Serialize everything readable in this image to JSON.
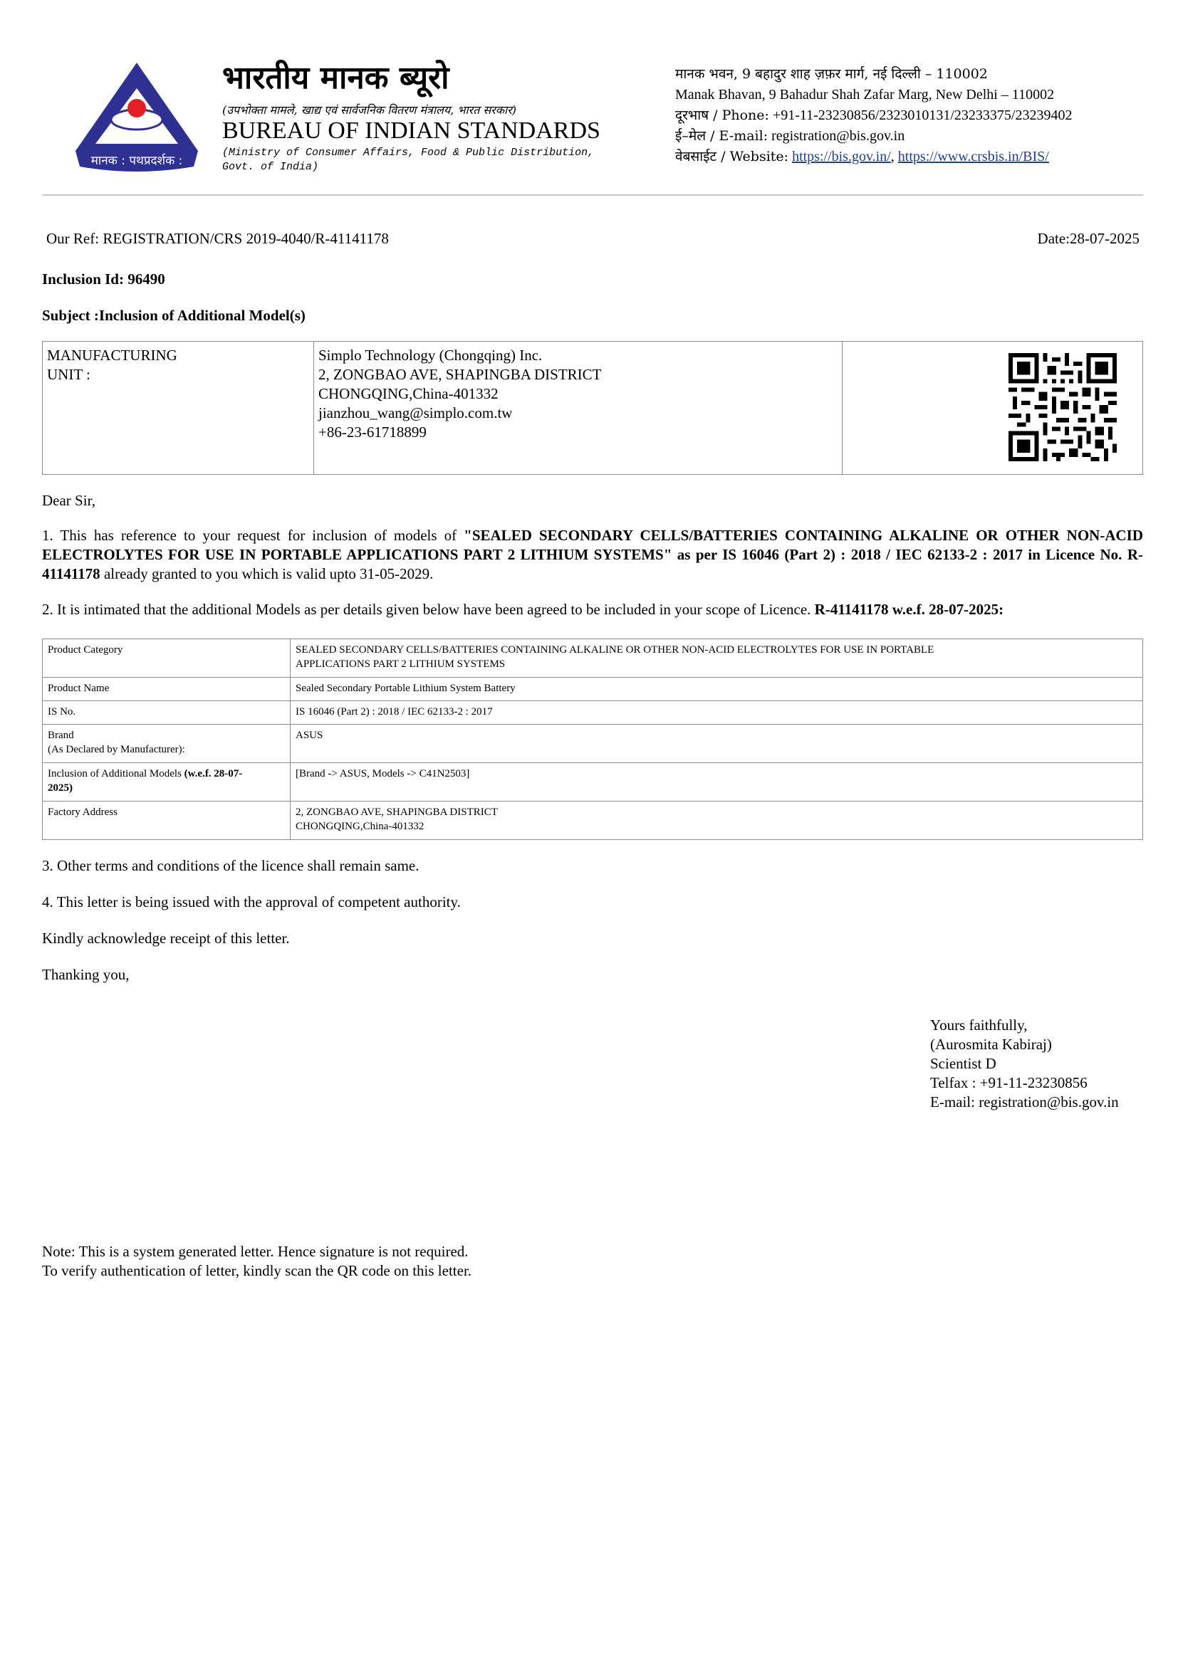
{
  "header": {
    "logo_text": "मानक : पथप्रदर्शक :",
    "hindi_name": "भारतीय मानक ब्यूरो",
    "hindi_ministry": "(उपभोक्ता मामले, खाद्य एवं सार्वजनिक वितरण मंत्रालय, भारत सरकार)",
    "english_name": "BUREAU OF INDIAN STANDARDS",
    "ministry_line1": "(Ministry of Consumer Affairs, Food & Public Distribution,",
    "ministry_line2": "Govt. of India)",
    "address_hindi": "मानक भवन, 9 बहादुर शाह ज़फ़र मार्ग, नई दिल्ली – 110002",
    "address_english": "Manak Bhavan, 9 Bahadur Shah Zafar Marg, New Delhi – 110002",
    "phone_label": "दूरभाष / Phone:",
    "phone": "+91-11-23230856/2323010131/23233375/23239402",
    "email_label": "ई–मेल / E-mail:",
    "email": "registration@bis.gov.in",
    "website_label": "वेबसाईट / Website:",
    "website1": "https://bis.gov.in/",
    "website_sep": ",",
    "website2": "https://www.crsbis.in/BIS/"
  },
  "letter": {
    "our_ref": "Our Ref: REGISTRATION/CRS 2019-4040/R-41141178",
    "date": "Date:28-07-2025",
    "inclusion_id": "Inclusion Id: 96490",
    "subject": "Subject :Inclusion of Additional Model(s)",
    "mfg_label_1": "MANUFACTURING",
    "mfg_label_2": "UNIT :",
    "mfg_lines": [
      "Simplo Technology (Chongqing) Inc.",
      "2, ZONGBAO AVE, SHAPINGBA DISTRICT",
      "CHONGQING,China-401332",
      "jianzhou_wang@simplo.com.tw",
      "+86-23-61718899"
    ],
    "salutation": "Dear Sir,",
    "p1_a": "1. This has reference to your request for inclusion of models of ",
    "p1_b": "\"SEALED SECONDARY CELLS/BATTERIES CONTAINING ALKALINE OR OTHER NON-ACID ELECTROLYTES FOR USE IN PORTABLE APPLICATIONS PART 2 LITHIUM SYSTEMS\" as per IS 16046 (Part 2) : 2018 / IEC 62133-2 : 2017 in Licence No. R-41141178",
    "p1_c": " already granted to you which is valid upto 31-05-2029.",
    "p2_a": "2. It is intimated that the additional Models as per details given below have been agreed to be included in your scope of Licence. ",
    "p2_b": "R-41141178 w.e.f. 28-07-2025:",
    "p3": "3. Other terms and conditions of the licence shall remain same.",
    "p4": "4. This letter is being issued with the approval of competent authority.",
    "p5": "Kindly acknowledge receipt of this letter.",
    "p6": "Thanking you,"
  },
  "product_table": {
    "category_label": "Product Category",
    "category_value_1": "SEALED SECONDARY CELLS/BATTERIES CONTAINING ALKALINE OR OTHER NON-ACID ELECTROLYTES FOR USE IN PORTABLE",
    "category_value_2": "APPLICATIONS PART 2 LITHIUM SYSTEMS",
    "name_label": "Product Name",
    "name_value": "Sealed Secondary Portable Lithium System Battery",
    "is_label": "IS No.",
    "is_value": "IS 16046 (Part 2) : 2018 / IEC 62133-2 : 2017",
    "brand_label_1": "Brand",
    "brand_label_2": "(As Declared by Manufacturer):",
    "brand_value": "ASUS",
    "incl_label_a": "Inclusion of Additional Models ",
    "incl_label_b": "(w.e.f. 28-07-",
    "incl_label_c": "2025)",
    "incl_value": "[Brand -> ASUS, Models -> C41N2503]",
    "factory_label": "Factory Address",
    "factory_value_1": "2, ZONGBAO AVE, SHAPINGBA DISTRICT",
    "factory_value_2": "CHONGQING,China-401332"
  },
  "signature": {
    "lines": [
      "Yours faithfully,",
      "(Aurosmita Kabiraj)",
      "Scientist D",
      "Telfax : +91-11-23230856",
      "E-mail: registration@bis.gov.in"
    ]
  },
  "note": {
    "line1": "Note: This is a system generated letter. Hence signature is not required.",
    "line2": "To verify authentication of letter, kindly scan the QR code on this letter."
  },
  "colors": {
    "logo_blue": "#2e3192",
    "logo_red": "#e31e24",
    "link": "#1f3f8f",
    "rule": "#c9c9c9"
  }
}
